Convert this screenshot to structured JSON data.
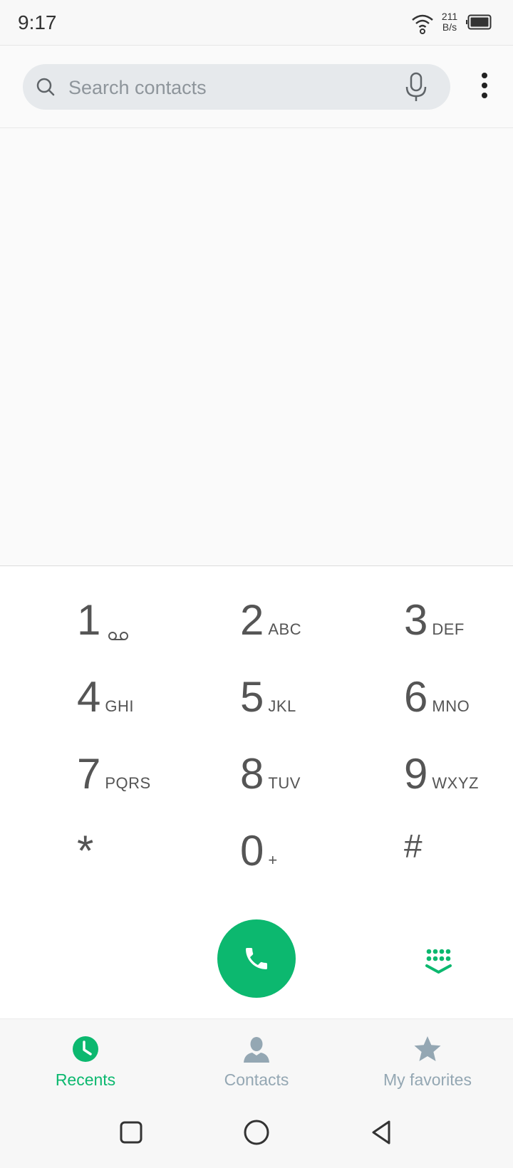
{
  "status_bar": {
    "time": "9:17",
    "net_speed_value": "211",
    "net_speed_unit": "B/s",
    "icons": [
      "wifi-icon",
      "battery-icon"
    ]
  },
  "search": {
    "placeholder": "Search contacts",
    "icons": [
      "search-icon",
      "mic-icon",
      "more-icon"
    ]
  },
  "dialpad": {
    "keys": [
      {
        "digit": "1",
        "letters": "",
        "icon": "voicemail-icon"
      },
      {
        "digit": "2",
        "letters": "ABC"
      },
      {
        "digit": "3",
        "letters": "DEF"
      },
      {
        "digit": "4",
        "letters": "GHI"
      },
      {
        "digit": "5",
        "letters": "JKL"
      },
      {
        "digit": "6",
        "letters": "MNO"
      },
      {
        "digit": "7",
        "letters": "PQRS"
      },
      {
        "digit": "8",
        "letters": "TUV"
      },
      {
        "digit": "9",
        "letters": "WXYZ"
      },
      {
        "digit": "*",
        "letters": ""
      },
      {
        "digit": "0",
        "letters": "+"
      },
      {
        "digit": "#",
        "letters": ""
      }
    ],
    "call_icon": "phone-icon",
    "toggle_icon": "dialpad-icon"
  },
  "tabs": [
    {
      "label": "Recents",
      "icon": "clock-icon",
      "active": true
    },
    {
      "label": "Contacts",
      "icon": "person-icon",
      "active": false
    },
    {
      "label": "My favorites",
      "icon": "star-icon",
      "active": false
    }
  ],
  "colors": {
    "accent": "#0cb86f",
    "inactive_tab": "#94a7b3",
    "search_bg": "#e6e9ec"
  },
  "system_nav": [
    "recent-apps-icon",
    "home-icon",
    "back-icon"
  ]
}
